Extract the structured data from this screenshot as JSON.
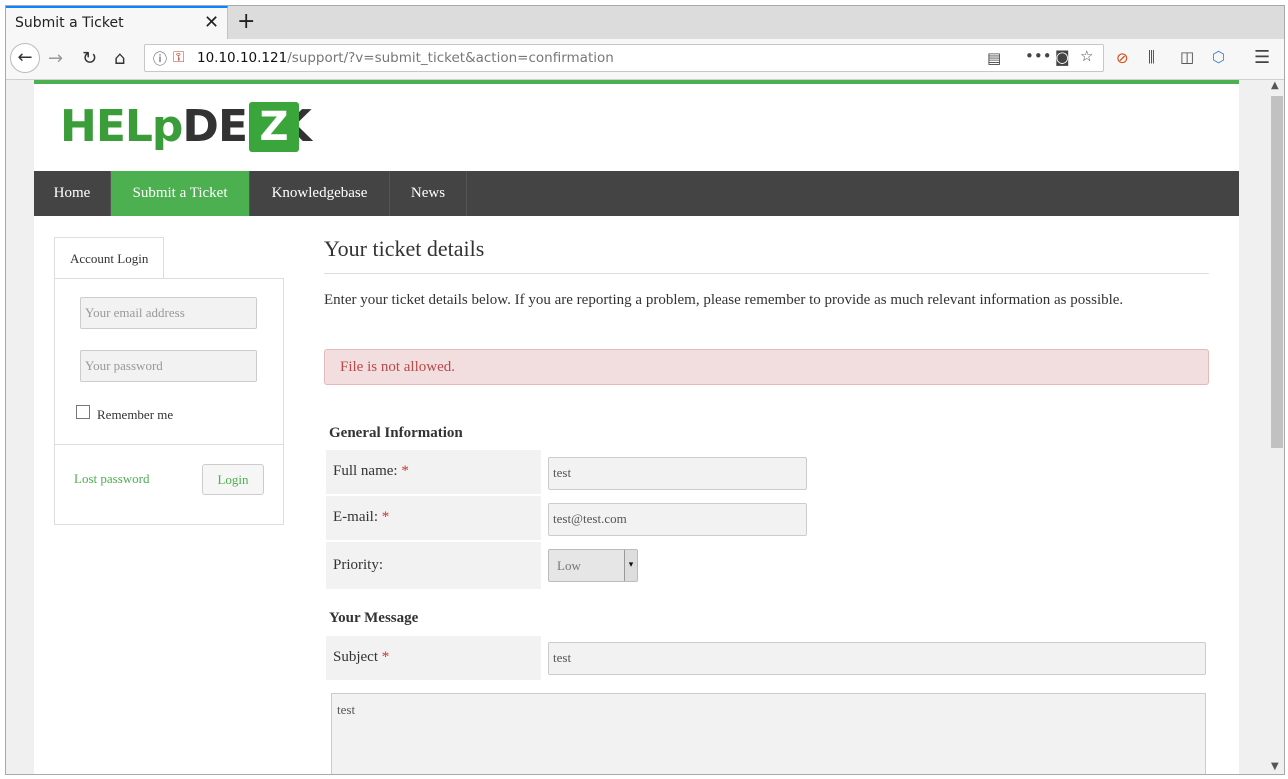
{
  "browser": {
    "tab_title": "Submit a Ticket",
    "tab_close": "✕",
    "new_tab": "+",
    "url_host": "10.10.10.121",
    "url_path": "/support/?v=submit_ticket&action=confirmation"
  },
  "logo": {
    "text_green": "HELp",
    "text_dark": "DESK",
    "badge": "Z"
  },
  "menu": {
    "items": [
      {
        "label": "Home"
      },
      {
        "label": "Submit a Ticket"
      },
      {
        "label": "Knowledgebase"
      },
      {
        "label": "News"
      }
    ]
  },
  "sidebar": {
    "tab_label": "Account Login",
    "email_placeholder": "Your email address",
    "password_placeholder": "Your password",
    "remember_label": "Remember me",
    "lost_password": "Lost password",
    "login_button": "Login"
  },
  "main": {
    "title": "Your ticket details",
    "intro": "Enter your ticket details below. If you are reporting a problem, please remember to provide as much relevant information as possible.",
    "alert": "File is not allowed.",
    "general_heading": "General Information",
    "full_name_label": "Full name:",
    "full_name_value": "test",
    "email_label": "E-mail:",
    "email_value": "test@test.com",
    "priority_label": "Priority:",
    "priority_value": "Low",
    "message_heading": "Your Message",
    "subject_label": "Subject",
    "subject_value": "test",
    "message_value": "test",
    "required_mark": "*"
  }
}
